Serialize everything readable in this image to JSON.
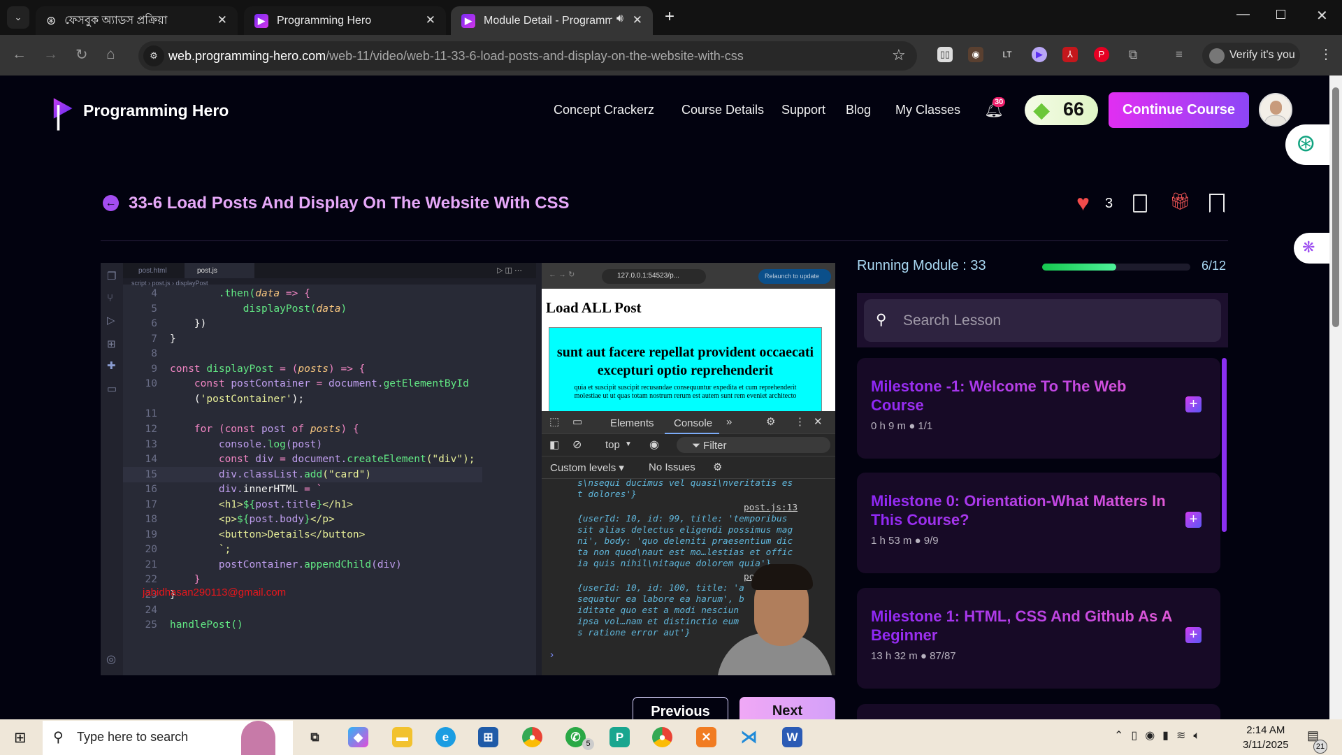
{
  "browser": {
    "tabs": [
      {
        "label": "ফেসবুক অ্যাডস প্রক্রিয়া",
        "icon": "chatgpt-icon"
      },
      {
        "label": "Programming Hero",
        "icon": "programming-hero-icon"
      },
      {
        "label": "Module Detail - Programmi",
        "icon": "programming-hero-icon",
        "active": true
      }
    ],
    "url_host": "web.programming-hero.com",
    "url_path": "/web-11/video/web-11-33-6-load-posts-and-display-on-the-website-with-css",
    "verify_label": "Verify it's you"
  },
  "header": {
    "brand": "Programming Hero",
    "nav": [
      "Concept Crackerz",
      "Course Details",
      "Support",
      "Blog",
      "My Classes"
    ],
    "notification_count": "30",
    "gems": "66",
    "continue_label": "Continue Course"
  },
  "lesson": {
    "title": "33-6 Load Posts And Display On The Website With CSS",
    "likes": "3"
  },
  "video": {
    "editor_tabs": [
      "post.html",
      "post.js"
    ],
    "breadcrumb": [
      "script",
      "post.js",
      "displayPost"
    ],
    "code": [
      {
        "n": "4",
        "t": [
          [
            "        ",
            "pu"
          ],
          [
            ".then(",
            "fn"
          ],
          [
            "data",
            "pa"
          ],
          [
            " => {",
            "kw"
          ]
        ]
      },
      {
        "n": "5",
        "t": [
          [
            "            ",
            "pu"
          ],
          [
            "displayPost(",
            "fn"
          ],
          [
            "data",
            "pa"
          ],
          [
            ")",
            "fn"
          ]
        ]
      },
      {
        "n": "6",
        "t": [
          [
            "    })",
            "pu"
          ]
        ]
      },
      {
        "n": "7",
        "t": [
          [
            "}",
            "pu"
          ]
        ]
      },
      {
        "n": "8",
        "t": []
      },
      {
        "n": "9",
        "t": [
          [
            "const ",
            "kw"
          ],
          [
            "displayPost ",
            "fn"
          ],
          [
            "= (",
            "kw"
          ],
          [
            "posts",
            "pa"
          ],
          [
            ") => {",
            "kw"
          ]
        ]
      },
      {
        "n": "10",
        "t": [
          [
            "    const ",
            "kw"
          ],
          [
            "postContainer ",
            "vr"
          ],
          [
            "= ",
            "kw"
          ],
          [
            "document.",
            "vr"
          ],
          [
            "getElementById",
            "fn"
          ]
        ]
      },
      {
        "n": "",
        "t": [
          [
            "    (",
            "pu"
          ],
          [
            "'postContainer'",
            "st"
          ],
          [
            ");",
            "pu"
          ]
        ]
      },
      {
        "n": "11",
        "t": []
      },
      {
        "n": "12",
        "t": [
          [
            "    for (const ",
            "kw"
          ],
          [
            "post ",
            "vr"
          ],
          [
            "of ",
            "kw"
          ],
          [
            "posts",
            "pa"
          ],
          [
            ") {",
            "kw"
          ]
        ]
      },
      {
        "n": "13",
        "t": [
          [
            "        console.",
            "vr"
          ],
          [
            "log",
            "fn"
          ],
          [
            "(post)",
            "vr"
          ]
        ]
      },
      {
        "n": "14",
        "t": [
          [
            "        const ",
            "kw"
          ],
          [
            "div ",
            "vr"
          ],
          [
            "= ",
            "kw"
          ],
          [
            "document.",
            "vr"
          ],
          [
            "createElement",
            "fn"
          ],
          [
            "(\"div\");",
            "st"
          ]
        ]
      },
      {
        "n": "15",
        "t": [
          [
            "        div.classList.",
            "vr"
          ],
          [
            "add",
            "fn"
          ],
          [
            "(\"card\")",
            "st"
          ]
        ]
      },
      {
        "n": "16",
        "t": [
          [
            "        div.",
            "vr"
          ],
          [
            "innerHTML ",
            "pu"
          ],
          [
            "= `",
            "kw"
          ]
        ]
      },
      {
        "n": "17",
        "t": [
          [
            "        <h1>",
            "st"
          ],
          [
            "${",
            "fn"
          ],
          [
            "post.title",
            "vr"
          ],
          [
            "}",
            "fn"
          ],
          [
            "</h1>",
            "st"
          ]
        ]
      },
      {
        "n": "18",
        "t": [
          [
            "        <p>",
            "st"
          ],
          [
            "${",
            "fn"
          ],
          [
            "post.body",
            "vr"
          ],
          [
            "}",
            "fn"
          ],
          [
            "</p>",
            "st"
          ]
        ]
      },
      {
        "n": "19",
        "t": [
          [
            "        <button>Details</button>",
            "st"
          ]
        ]
      },
      {
        "n": "20",
        "t": [
          [
            "        `;",
            "st"
          ]
        ]
      },
      {
        "n": "21",
        "t": [
          [
            "        postContainer.",
            "vr"
          ],
          [
            "appendChild",
            "fn"
          ],
          [
            "(div)",
            "vr"
          ]
        ]
      },
      {
        "n": "22",
        "t": [
          [
            "    }",
            "kw"
          ]
        ]
      },
      {
        "n": "23",
        "t": [
          [
            "}",
            "pu"
          ]
        ]
      },
      {
        "n": "24",
        "t": []
      },
      {
        "n": "25",
        "t": [
          [
            "handlePost()",
            "fn"
          ]
        ]
      }
    ],
    "watermark_email": "jabidhasan290113@gmail.com",
    "preview_url": "127.0.0.1:54523/p...",
    "relaunch_label": "Relaunch to update",
    "page_heading": "Load ALL Post",
    "card_title": "sunt aut facere repellat provident occaecati excepturi optio reprehenderit",
    "card_body": "quia et suscipit suscipit recusandae consequuntur expedita et cum reprehenderit molestiae ut ut quas totam nostrum rerum est autem sunt rem eveniet architecto",
    "devtools": {
      "tabs": [
        "Elements",
        "Console"
      ],
      "context": "top",
      "filter_placeholder": "Filter",
      "levels": "Custom levels",
      "issues": "No Issues",
      "console_lines": [
        "s\\nsequi ducimus vel quasi\\nveritatis es\nt dolores'}",
        "{userId: 10, id: 99, title: 'temporibus\nsit alias delectus eligendi possimus mag\nni', body: 'quo deleniti praesentium dic\nta non quod\\naut est mo…lestias et offic\nia quis nihil\\nitaque dolorem quia'}",
        "{userId: 10, id: 100, title: 'a\nsequatur ea labore ea harum', b\niditate quo est a modi nesciun\nipsa vol…nam et distinctio eum\ns ratione error aut'}"
      ],
      "source_link": "post.js:13",
      "source_link_partial": "po"
    }
  },
  "sidebar": {
    "running_label": "Running Module : 33",
    "progress": 0.5,
    "progress_text": "6/12",
    "search_placeholder": "Search Lesson",
    "milestones": [
      {
        "title": "Milestone -1: Welcome To The Web Course",
        "meta": "0 h 9 m ●  1/1"
      },
      {
        "title": "Milestone 0: Orientation-What Matters In This Course?",
        "meta": "1 h 53 m ●  9/9"
      },
      {
        "title": "Milestone 1: HTML, CSS And Github As A Beginner",
        "meta": "13 h 32 m ●  87/87"
      }
    ],
    "previous_label": "Previous",
    "next_label": "Next"
  },
  "taskbar": {
    "search_placeholder": "Type here to search",
    "whatsapp_badge": "5",
    "time": "2:14 AM",
    "date": "3/11/2025",
    "notifications": "21"
  }
}
